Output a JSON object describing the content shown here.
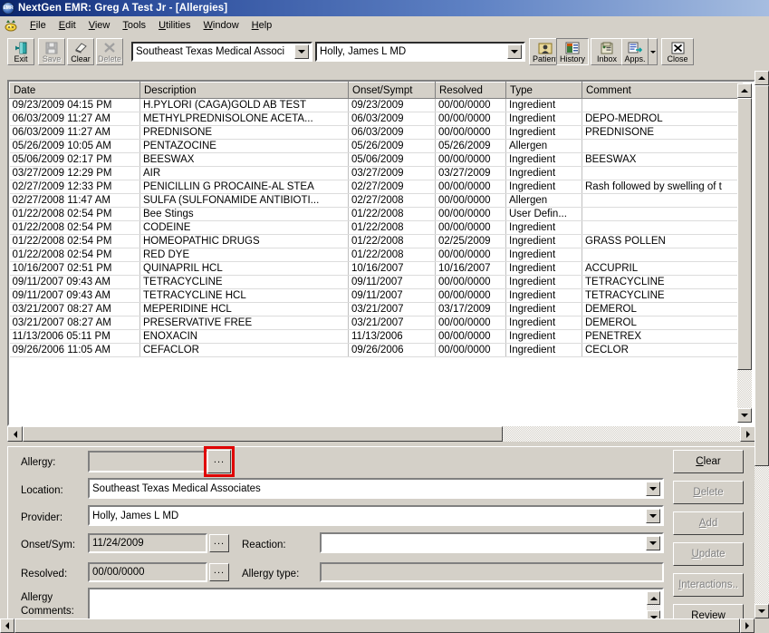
{
  "window": {
    "title": "NextGen EMR: Greg A Test Jr - [Allergies]",
    "icon": "emr-app-icon"
  },
  "menubar": {
    "mdi_icon": "mdi-child-icon",
    "items": [
      {
        "label": "File",
        "accel": "F"
      },
      {
        "label": "Edit",
        "accel": "E"
      },
      {
        "label": "View",
        "accel": "V"
      },
      {
        "label": "Tools",
        "accel": "T"
      },
      {
        "label": "Utilities",
        "accel": "U"
      },
      {
        "label": "Window",
        "accel": "W"
      },
      {
        "label": "Help",
        "accel": "H"
      }
    ]
  },
  "toolbar": {
    "exit_label": "Exit",
    "save_label": "Save",
    "clear_label": "Clear",
    "delete_label": "Delete",
    "location_combo": "Southeast Texas Medical Associ",
    "provider_combo": "Holly, James  L MD",
    "patient_label": "Patient",
    "history_label": "History",
    "inbox_label": "Inbox",
    "apps_label": "Apps.",
    "close_label": "Close"
  },
  "grid": {
    "columns": [
      "Date",
      "Description",
      "Onset/Sympt",
      "Resolved",
      "Type",
      "Comment"
    ],
    "rows": [
      [
        "09/23/2009 04:15 PM",
        "H.PYLORI (CAGA)GOLD AB TEST",
        "09/23/2009",
        "00/00/0000",
        "Ingredient",
        ""
      ],
      [
        "06/03/2009 11:27 AM",
        "METHYLPREDNISOLONE ACETA...",
        "06/03/2009",
        "00/00/0000",
        "Ingredient",
        "DEPO-MEDROL"
      ],
      [
        "06/03/2009 11:27 AM",
        "PREDNISONE",
        "06/03/2009",
        "00/00/0000",
        "Ingredient",
        "PREDNISONE"
      ],
      [
        "05/26/2009 10:05 AM",
        "PENTAZOCINE",
        "05/26/2009",
        "05/26/2009",
        "Allergen",
        ""
      ],
      [
        "05/06/2009 02:17 PM",
        "BEESWAX",
        "05/06/2009",
        "00/00/0000",
        "Ingredient",
        "BEESWAX"
      ],
      [
        "03/27/2009 12:29 PM",
        "AIR",
        "03/27/2009",
        "03/27/2009",
        "Ingredient",
        ""
      ],
      [
        "02/27/2009 12:33 PM",
        "PENICILLIN G PROCAINE-AL STEA",
        "02/27/2009",
        "00/00/0000",
        "Ingredient",
        "Rash followed by swelling of t"
      ],
      [
        "02/27/2008 11:47 AM",
        "SULFA (SULFONAMIDE ANTIBIOTI...",
        "02/27/2008",
        "00/00/0000",
        "Allergen",
        ""
      ],
      [
        "01/22/2008 02:54 PM",
        "Bee Stings",
        "01/22/2008",
        "00/00/0000",
        "User Defin...",
        ""
      ],
      [
        "01/22/2008 02:54 PM",
        "CODEINE",
        "01/22/2008",
        "00/00/0000",
        "Ingredient",
        ""
      ],
      [
        "01/22/2008 02:54 PM",
        "HOMEOPATHIC DRUGS",
        "01/22/2008",
        "02/25/2009",
        "Ingredient",
        "GRASS POLLEN"
      ],
      [
        "01/22/2008 02:54 PM",
        "RED DYE",
        "01/22/2008",
        "00/00/0000",
        "Ingredient",
        ""
      ],
      [
        "10/16/2007 02:51 PM",
        "QUINAPRIL HCL",
        "10/16/2007",
        "10/16/2007",
        "Ingredient",
        "ACCUPRIL"
      ],
      [
        "09/11/2007 09:43 AM",
        "TETRACYCLINE",
        "09/11/2007",
        "00/00/0000",
        "Ingredient",
        "TETRACYCLINE"
      ],
      [
        "09/11/2007 09:43 AM",
        "TETRACYCLINE HCL",
        "09/11/2007",
        "00/00/0000",
        "Ingredient",
        "TETRACYCLINE"
      ],
      [
        "03/21/2007 08:27 AM",
        "MEPERIDINE HCL",
        "03/21/2007",
        "03/17/2009",
        "Ingredient",
        "DEMEROL"
      ],
      [
        "03/21/2007 08:27 AM",
        "PRESERVATIVE FREE",
        "03/21/2007",
        "00/00/0000",
        "Ingredient",
        "DEMEROL"
      ],
      [
        "11/13/2006 05:11 PM",
        "ENOXACIN",
        "11/13/2006",
        "00/00/0000",
        "Ingredient",
        "PENETREX"
      ],
      [
        "09/26/2006 11:05 AM",
        "CEFACLOR",
        "09/26/2006",
        "00/00/0000",
        "Ingredient",
        "CECLOR"
      ]
    ]
  },
  "form": {
    "allergy_label": "Allergy:",
    "allergy_value": "",
    "allergy_browse": "...",
    "location_label": "Location:",
    "location_value": "Southeast Texas Medical Associates",
    "provider_label": "Provider:",
    "provider_value": "Holly, James  L MD",
    "onset_label": "Onset/Sym:",
    "onset_value": "11/24/2009",
    "onset_browse": "...",
    "resolved_label": "Resolved:",
    "resolved_value": "00/00/0000",
    "resolved_browse": "...",
    "reaction_label": "Reaction:",
    "reaction_value": "",
    "allergy_type_label": "Allergy type:",
    "allergy_type_value": "",
    "comments_label_line1": "Allergy",
    "comments_label_line2": "Comments:",
    "comments_value": ""
  },
  "actions": {
    "clear": {
      "label": "Clear",
      "accel": "C",
      "disabled": false
    },
    "delete": {
      "label": "Delete",
      "accel": "D",
      "disabled": true
    },
    "add": {
      "label": "Add",
      "accel": "A",
      "disabled": true
    },
    "update": {
      "label": "Update",
      "accel": "U",
      "disabled": true
    },
    "interactions": {
      "label": "Interactions..",
      "accel": "I",
      "disabled": true
    },
    "review": {
      "label": "Review",
      "accel": "R",
      "disabled": false
    }
  },
  "highlight": {
    "color": "#e00000",
    "target": "allergy-browse-button"
  }
}
